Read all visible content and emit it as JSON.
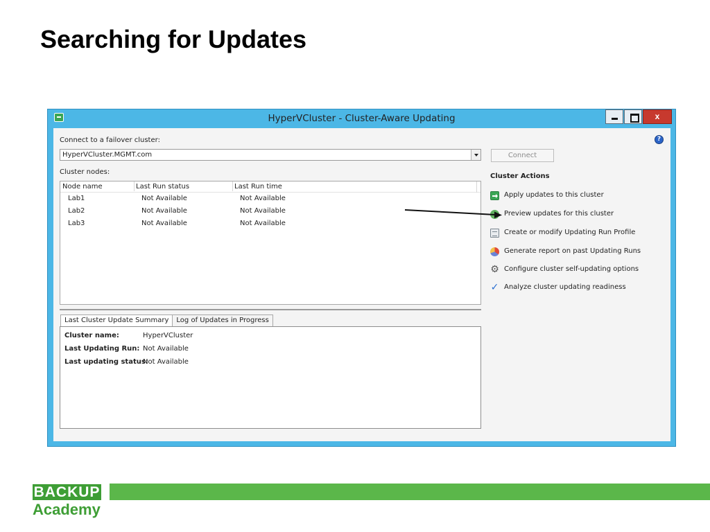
{
  "slide": {
    "title": "Searching for Updates"
  },
  "window": {
    "title": "HyperVCluster - Cluster-Aware Updating",
    "close_label": "x"
  },
  "connect": {
    "label": "Connect to a failover cluster:",
    "value": "HyperVCluster.MGMT.com",
    "button_label": "Connect"
  },
  "nodes": {
    "label": "Cluster nodes:",
    "columns": [
      "Node name",
      "Last Run status",
      "Last Run time"
    ],
    "rows": [
      [
        "Lab1",
        "Not Available",
        "Not Available"
      ],
      [
        "Lab2",
        "Not Available",
        "Not Available"
      ],
      [
        "Lab3",
        "Not Available",
        "Not Available"
      ]
    ]
  },
  "tabs": [
    "Last Cluster Update Summary",
    "Log of Updates in Progress"
  ],
  "summary": {
    "rows": [
      {
        "label": "Cluster name:",
        "value": "HyperVCluster"
      },
      {
        "label": "Last Updating Run:",
        "value": "Not Available"
      },
      {
        "label": "Last updating status:",
        "value": "Not Available"
      }
    ]
  },
  "actions": {
    "title": "Cluster Actions",
    "items": [
      {
        "label": "Apply updates to this cluster",
        "icon": "apply-updates-icon"
      },
      {
        "label": "Preview updates for this cluster",
        "icon": "preview-updates-icon"
      },
      {
        "label": "Create or modify Updating Run Profile",
        "icon": "profile-icon"
      },
      {
        "label": "Generate report on past Updating Runs",
        "icon": "report-icon"
      },
      {
        "label": "Configure cluster self-updating options",
        "icon": "gear-icon"
      },
      {
        "label": "Analyze cluster updating readiness",
        "icon": "checkmark-icon"
      }
    ]
  },
  "logo": {
    "brand": "BACKUP",
    "sub": "Academy"
  },
  "colors": {
    "brand_green": "#5bb74a",
    "window_frame": "#4cb7e6",
    "close_red": "#c7392e"
  }
}
